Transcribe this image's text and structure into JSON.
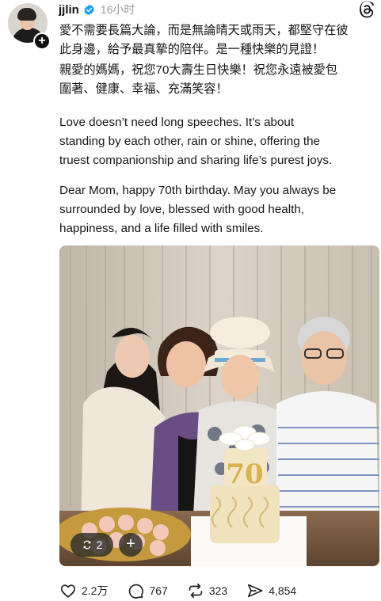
{
  "post": {
    "username": "jjlin",
    "time": "16小时",
    "follow_symbol": "+",
    "text_zh_1": [
      "愛不需要長篇大論，而是無論晴天或雨天，都堅守在彼",
      "此身邊，給予最真摯的陪伴。是一種快樂的見證！"
    ],
    "text_zh_2": [
      "親愛的媽媽，祝您70大壽生日快樂！祝您永遠被愛包",
      "圍著、健康、幸福、充滿笑容！"
    ],
    "text_en_1": [
      "Love doesn’t need long speeches. It’s about",
      "standing by each other, rain or shine, offering the",
      "truest companionship and sharing life’s purest joys."
    ],
    "text_en_2": [
      "Dear Mom, happy 70th birthday. May you always be",
      "surrounded by love, blessed with good health,",
      "happiness, and a life filled with smiles."
    ],
    "cake_topper": "70",
    "carousel_count": "2",
    "add_symbol": "+"
  },
  "actions": {
    "likes": "2.2万",
    "replies": "767",
    "reposts": "323",
    "shares": "4,854"
  },
  "colors": {
    "verified": "#1d9bf0",
    "text": "#161616",
    "muted": "#9a9a9a"
  },
  "icons": [
    "verified-icon",
    "threads-logo-icon",
    "heart-icon",
    "comment-icon",
    "repost-icon",
    "share-icon",
    "carousel-icon",
    "plus-icon"
  ]
}
